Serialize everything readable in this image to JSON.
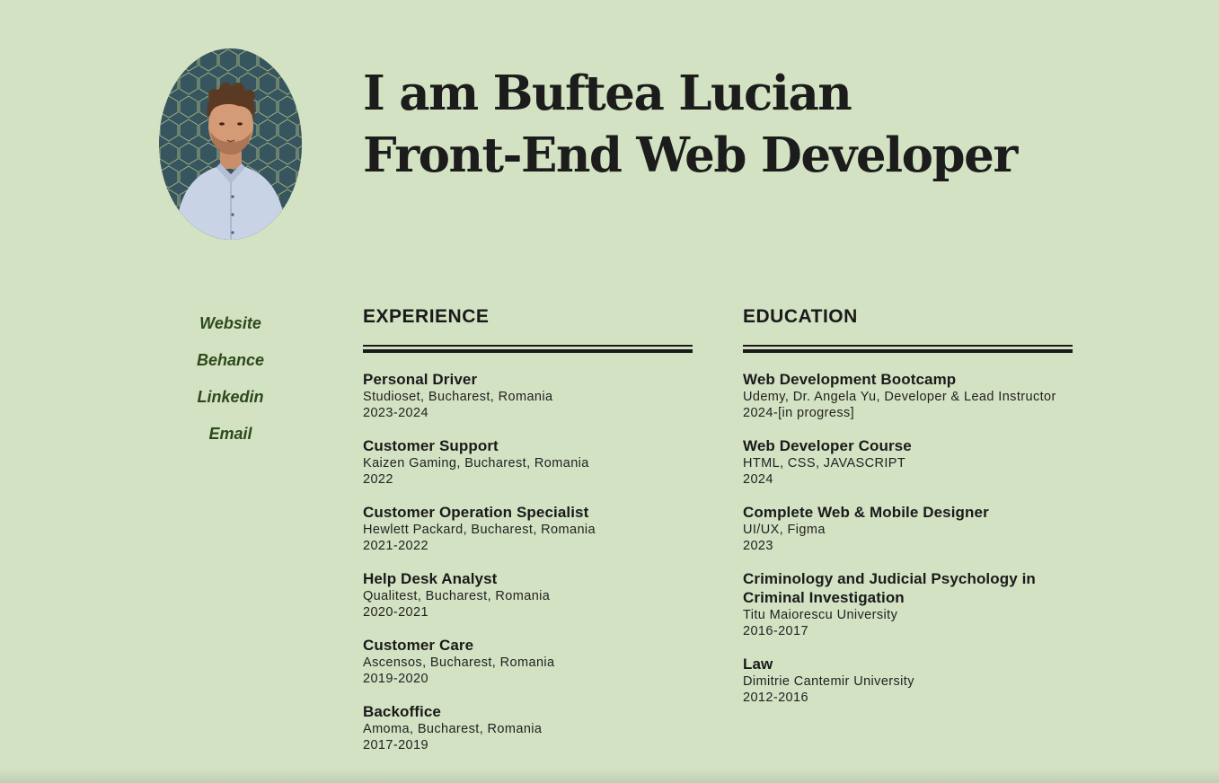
{
  "hero": {
    "line1": "I am Buftea Lucian",
    "line2": "Front-End Web Developer"
  },
  "links": [
    "Website",
    "Behance",
    "Linkedin",
    "Email"
  ],
  "experience": {
    "heading": "EXPERIENCE",
    "items": [
      {
        "title": "Personal Driver",
        "sub": "Studioset, Bucharest, Romania",
        "years": "2023-2024"
      },
      {
        "title": "Customer Support",
        "sub": "Kaizen Gaming, Bucharest, Romania",
        "years": "2022"
      },
      {
        "title": "Customer Operation Specialist",
        "sub": "Hewlett Packard, Bucharest, Romania",
        "years": "2021-2022"
      },
      {
        "title": "Help Desk Analyst",
        "sub": "Qualitest, Bucharest, Romania",
        "years": "2020-2021"
      },
      {
        "title": "Customer Care",
        "sub": "Ascensos, Bucharest, Romania",
        "years": "2019-2020"
      },
      {
        "title": "Backoffice",
        "sub": "Amoma, Bucharest, Romania",
        "years": "2017-2019"
      }
    ]
  },
  "education": {
    "heading": "EDUCATION",
    "items": [
      {
        "title": "Web Development Bootcamp",
        "sub": "Udemy, Dr. Angela Yu, Developer & Lead Instructor",
        "years": "2024-[in progress]"
      },
      {
        "title": "Web Developer Course",
        "sub": "HTML, CSS, JAVASCRIPT",
        "years": "2024"
      },
      {
        "title": "Complete Web & Mobile Designer",
        "sub": "UI/UX, Figma",
        "years": "2023"
      },
      {
        "title": "Criminology and Judicial Psychology in Criminal Investigation",
        "sub": "Titu Maiorescu University",
        "years": "2016-2017"
      },
      {
        "title": "Law",
        "sub": "Dimitrie Cantemir University",
        "years": "2012-2016"
      }
    ]
  },
  "colors": {
    "background": "#d3e2c3",
    "link": "#2c4a1c",
    "text": "#1a1a1a"
  }
}
